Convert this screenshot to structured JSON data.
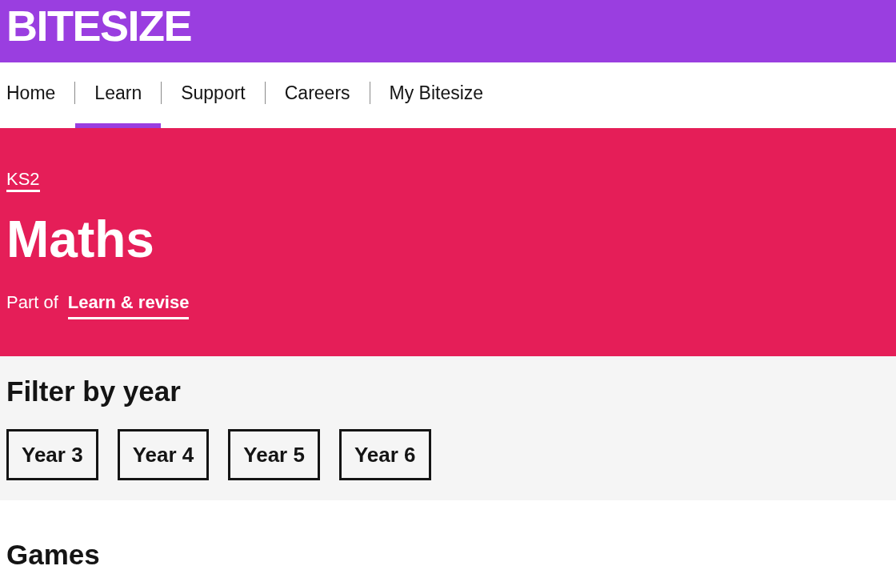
{
  "header": {
    "logo": "BITESIZE"
  },
  "nav": {
    "items": [
      {
        "label": "Home",
        "selected": false
      },
      {
        "label": "Learn",
        "selected": true
      },
      {
        "label": "Support",
        "selected": false
      },
      {
        "label": "Careers",
        "selected": false
      },
      {
        "label": "My Bitesize",
        "selected": false
      }
    ]
  },
  "hero": {
    "breadcrumb": "KS2",
    "title": "Maths",
    "part_of": {
      "prefix": "Part of",
      "link": "Learn & revise"
    }
  },
  "filter": {
    "heading": "Filter by year",
    "years": [
      "Year 3",
      "Year 4",
      "Year 5",
      "Year 6"
    ]
  },
  "games": {
    "heading": "Games"
  }
}
